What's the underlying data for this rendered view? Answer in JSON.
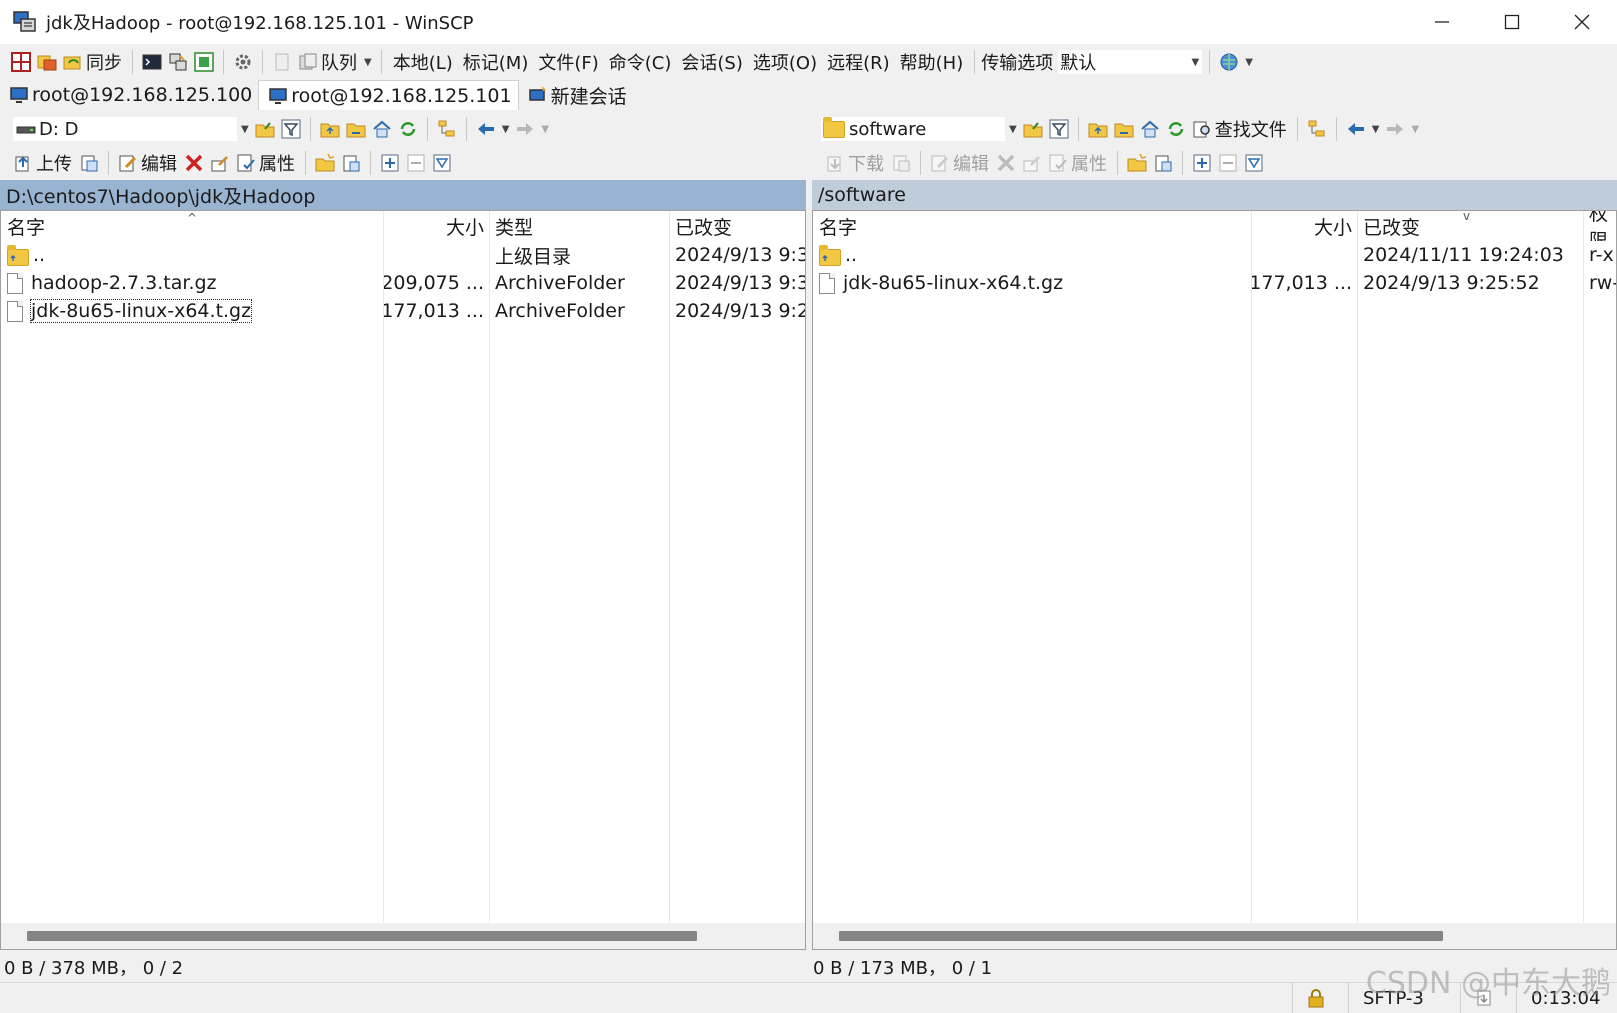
{
  "title": "jdk及Hadoop - root@192.168.125.101 - WinSCP",
  "toolbar": {
    "sync_label": "同步",
    "queue_label": "队列",
    "menu": [
      "本地(L)",
      "标记(M)",
      "文件(F)",
      "命令(C)",
      "会话(S)",
      "选项(O)",
      "远程(R)",
      "帮助(H)"
    ],
    "transfer_options_label": "传输选项",
    "transfer_options_value": "默认"
  },
  "tabs": [
    {
      "label": "root@192.168.125.100",
      "active": false
    },
    {
      "label": "root@192.168.125.101",
      "active": true
    },
    {
      "label": "新建会话",
      "active": false
    }
  ],
  "local": {
    "drive": "D: D",
    "actions": {
      "upload": "上传",
      "edit": "编辑",
      "properties": "属性"
    },
    "path": "D:\\centos7\\Hadoop\\jdk及Hadoop",
    "columns": {
      "name": "名字",
      "size": "大小",
      "type": "类型",
      "changed": "已改变"
    },
    "rows": [
      {
        "name": "..",
        "size": "",
        "type": "上级目录",
        "changed": "2024/9/13  9:3",
        "kind": "parent"
      },
      {
        "name": "hadoop-2.7.3.tar.gz",
        "size": "209,075 ...",
        "type": "ArchiveFolder",
        "changed": "2024/9/13  9:3",
        "kind": "file"
      },
      {
        "name": "jdk-8u65-linux-x64.t.gz",
        "size": "177,013 ...",
        "type": "ArchiveFolder",
        "changed": "2024/9/13  9:2",
        "kind": "file"
      }
    ],
    "status": "0 B / 378 MB，  0 / 2"
  },
  "remote": {
    "folder": "software",
    "find_files": "查找文件",
    "actions": {
      "download": "下载",
      "edit": "编辑",
      "properties": "属性"
    },
    "path": "/software",
    "columns": {
      "name": "名字",
      "size": "大小",
      "changed": "已改变",
      "rights": "权限"
    },
    "rows": [
      {
        "name": "..",
        "size": "",
        "changed": "2024/11/11 19:24:03",
        "rights": "r-x",
        "kind": "parent"
      },
      {
        "name": "jdk-8u65-linux-x64.t.gz",
        "size": "177,013 ...",
        "changed": "2024/9/13 9:25:52",
        "rights": "rw-",
        "kind": "file"
      }
    ],
    "status": "0 B / 173 MB，  0 / 1"
  },
  "statusbar": {
    "protocol": "SFTP-3",
    "elapsed": "0:13:04"
  },
  "watermark": "CSDN @中东大鹅"
}
